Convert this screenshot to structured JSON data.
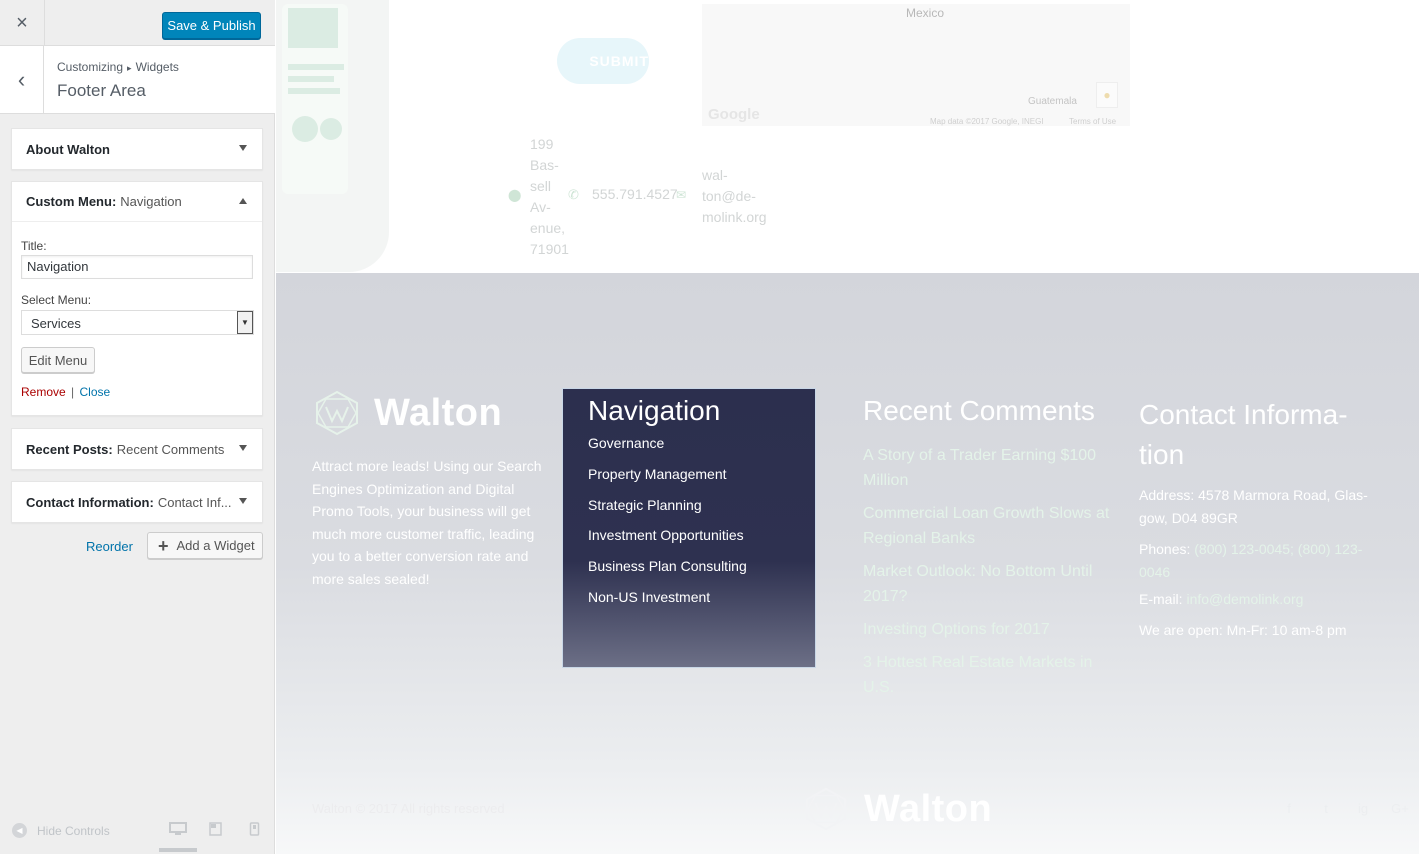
{
  "sidebar": {
    "close_glyph": "×",
    "publish_label": "Save & Publish",
    "back_glyph": "‹",
    "breadcrumb_root": "Customizing",
    "breadcrumb_sep": "▸",
    "breadcrumb_child": "Widgets",
    "section_title": "Footer Area",
    "widgets": {
      "about": {
        "title": "About Walton"
      },
      "menu": {
        "title": "Custom Menu:",
        "subtitle": "Navigation",
        "title_label": "Title:",
        "title_value": "Navigation",
        "select_label": "Select Menu:",
        "select_value": "Services",
        "edit_label": "Edit Menu",
        "remove_label": "Remove",
        "sep": "|",
        "close_label": "Close"
      },
      "recent": {
        "title": "Recent Posts:",
        "subtitle": "Recent Comments"
      },
      "contact": {
        "title": "Contact Information:",
        "subtitle": "Contact Inf..."
      }
    },
    "reorder_label": "Reorder",
    "add_widget_label": "Add a Widget",
    "hide_controls_label": "Hide Controls",
    "accent_color": "#0085ba"
  },
  "preview": {
    "submit_label": "SUBMIT",
    "map": {
      "country": "Mexico",
      "region": "Guatemala",
      "brand": "Google",
      "attribution": "Map data ©2017 Google, INEGI",
      "terms": "Terms of Use"
    },
    "address_short": "199 Bas-sell Av-enue, 71901",
    "phone_short": "555.791.4527",
    "email_short": "wal-ton@de-molink.org",
    "footer": {
      "brand_name": "Walton",
      "about_text": "Attract more leads! Using our Search Engines Optimization and Digital Promo Tools, your business will get much more customer traffic, leading you to a better conversion rate and more sales sealed!",
      "navigation": {
        "title": "Navigation",
        "items": [
          "Governance",
          "Property Management",
          "Strategic Planning",
          "Investment Opportunities",
          "Business Plan Consulting",
          "Non-US Investment"
        ]
      },
      "recent_comments": {
        "title": "Recent Comments",
        "items": [
          "A Story of a Trader Earning $100 Million",
          "Commercial Loan Growth Slows at Regional Banks",
          "Market Outlook: No Bottom Until 2017?",
          "Investing Options for 2017",
          "3 Hottest Real Estate Markets in U.S."
        ]
      },
      "contact": {
        "title": "Contact Informa-tion",
        "address": "Address: 4578 Marmora Road, Glas-gow, D04 89GR",
        "phones_label": "Phones:",
        "phone1": "(800) 123-0045",
        "phone_sep": ";",
        "phone2": "(800) 123-0046",
        "email_label": "E-mail:",
        "email": "info@demolink.org",
        "hours": "We are open: Mn-Fr: 10 am-8 pm"
      },
      "copyright": "Walton © 2017 All rights reserved",
      "bottom_brand": "Walton",
      "socials": [
        "f",
        "t",
        "ig",
        "G+"
      ]
    },
    "nav_box_color": "#2c2f4e",
    "link_green": "#e4f3e9"
  }
}
